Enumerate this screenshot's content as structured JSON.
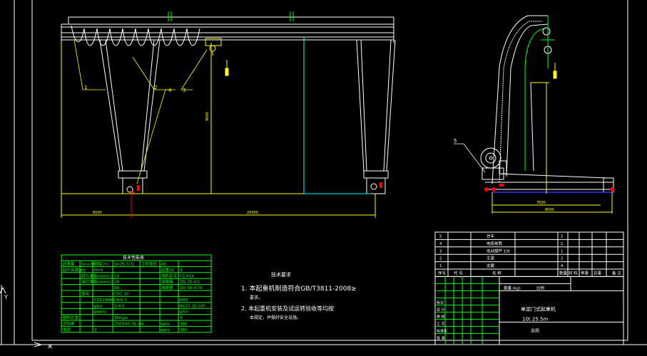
{
  "colors": {
    "background": "#000000",
    "structure": "#ffffff",
    "dimension": "#ffff00",
    "centerline": "#00ffff",
    "table_border": "#00ff00",
    "leader": "#ffff00",
    "red": "#ff0000",
    "blue": "#3333ff"
  },
  "front_view": {
    "part_labels": [
      "1",
      "2",
      "4",
      "3"
    ],
    "dim_labels": [
      "6000",
      "20000",
      "9000"
    ]
  },
  "side_view": {
    "part_label": "5",
    "dim_labels": [
      "7600",
      "8000"
    ]
  },
  "tech_requirements": {
    "title": "技术要求",
    "items": [
      "1. 本起重机制造符合GB/T3811-2008≥",
      "要求。",
      "2. 本起重机安装及试运转验收等均按",
      "本规定，并做好安全设施。"
    ]
  },
  "param_table": {
    "title": "技术性能表",
    "rows": [
      [
        "起重量",
        "Gn=30",
        "跨度(m)",
        "S=25.5(3)",
        "工作级别",
        "A5"
      ],
      [
        "起升高度(m)",
        "",
        "H=9",
        "",
        "",
        "起重(t)",
        "3"
      ],
      [
        "",
        "起升速度(m/min)",
        "",
        "10",
        "",
        "电机型号",
        "YZ-R5X"
      ],
      [
        "",
        "运行速度(m/min)",
        "",
        "20",
        "",
        "减速器",
        "ZQ-25-4/5"
      ],
      [
        "",
        "",
        "",
        "50",
        "",
        "减速器",
        "ZQ-50-4/75"
      ],
      [
        "",
        "型号",
        "",
        "CD1 30",
        "",
        "",
        ""
      ],
      [
        "",
        "",
        "YZR250M2-6/8.5",
        "",
        "",
        "",
        "M85"
      ],
      [
        "",
        "",
        "φ(v)",
        "2-0.5",
        "",
        "",
        "6X37-15-185"
      ],
      [
        "",
        "",
        "φ(m/s)",
        "",
        "",
        "",
        "φ5/0"
      ],
      [
        "整机总重",
        "",
        "",
        "35Kg/n",
        "",
        "",
        "3"
      ],
      [
        "总功率",
        "",
        "",
        "ZSC600-39-3/4",
        "",
        "φ(v)",
        "380"
      ],
      [
        "电源",
        "",
        "3",
        "",
        "",
        "φ(v)",
        "380"
      ]
    ]
  },
  "title_block": {
    "parts": [
      {
        "no": "5",
        "name": "台车",
        "qty": "2"
      },
      {
        "no": "4",
        "name": "电缆卷筒",
        "qty": "1"
      },
      {
        "no": "3",
        "name": "电动葫芦 10t",
        "qty": "1"
      },
      {
        "no": "2",
        "name": "主梁",
        "qty": "2"
      },
      {
        "no": "1",
        "name": "支腿",
        "qty": "4"
      }
    ],
    "col_headers": [
      "序号",
      "代 号",
      "名 称",
      "数量",
      "材 料",
      "单重",
      "总重",
      "备 注"
    ],
    "row_labels": [
      "标记",
      "设 计",
      "审 核",
      "工 艺",
      "标准化",
      "批 准"
    ],
    "weight_label": "重量 (kg)",
    "scale_label": "比例",
    "drawing_title": "单梁门式起重机",
    "drawing_spec": "10t  25.5m",
    "sheet": "总图"
  }
}
